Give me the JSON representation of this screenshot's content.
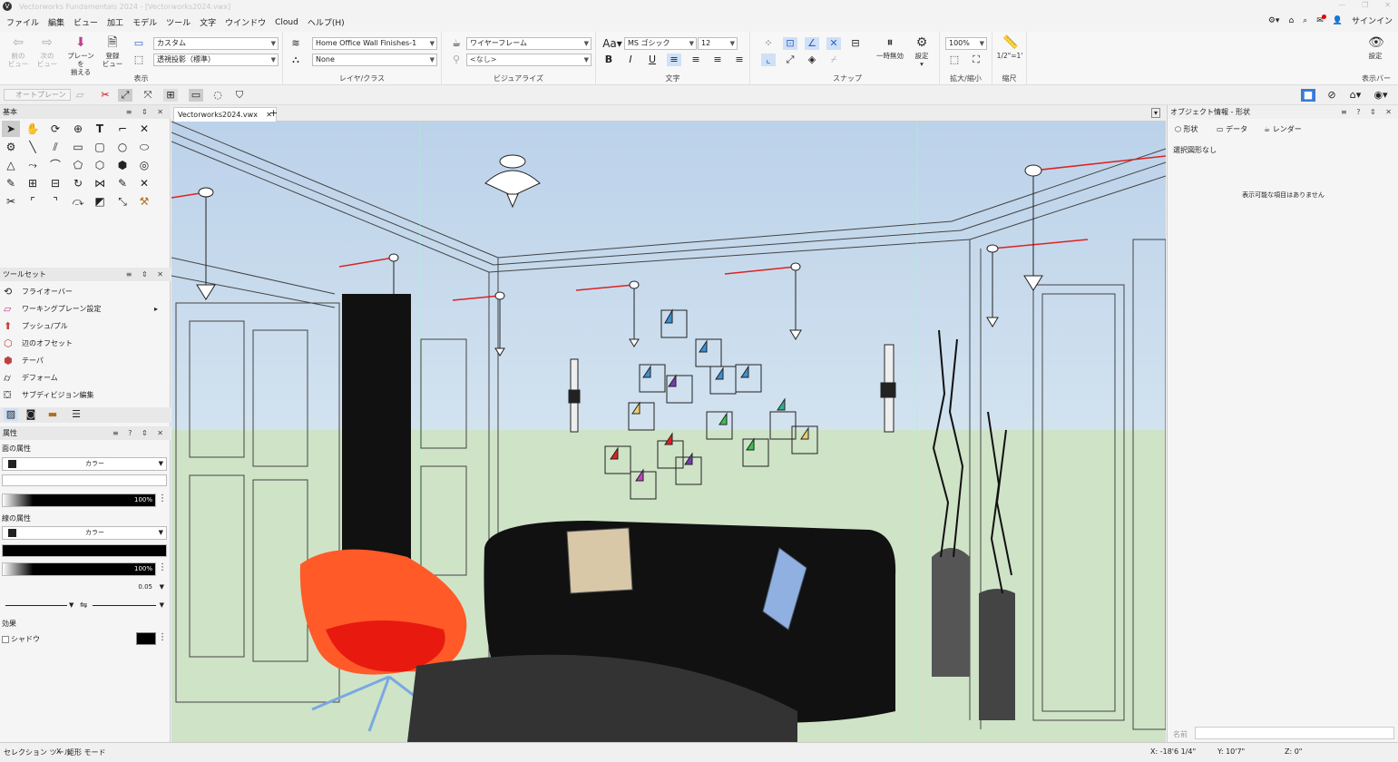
{
  "app": {
    "title": "Vectorworks Fundamentals 2024 - [Vectorworks2024.vwx]",
    "logo": "V"
  },
  "menu": [
    "ファイル",
    "編集",
    "ビュー",
    "加工",
    "モデル",
    "ツール",
    "文字",
    "ウインドウ",
    "Cloud",
    "ヘルプ(H)"
  ],
  "right_menu": {
    "signin": "サインイン"
  },
  "ribbon": {
    "view": {
      "prev": "前の\nビュー",
      "next": "次の\nビュー",
      "align_plane": "プレーンを\n揃える",
      "register": "登録\nビュー",
      "view_dd": "カスタム",
      "proj_dd": "透視投影（標準）",
      "label": "表示"
    },
    "layer": {
      "layer_dd": "Home Office Wall Finishes-1",
      "class_dd": "None",
      "label": "レイヤ/クラス"
    },
    "visual": {
      "render_dd": "ワイヤーフレーム",
      "style_dd": "<なし>",
      "label": "ビジュアライズ"
    },
    "text": {
      "font_dd": "MS ゴシック",
      "size_dd": "12",
      "bold": "B",
      "italic": "I",
      "underline": "U",
      "label": "文字"
    },
    "snap": {
      "pause": "一時無効",
      "settings": "設定",
      "label": "スナップ"
    },
    "zoom": {
      "zoom_dd": "100%",
      "label": "拡大/縮小"
    },
    "scale": {
      "value": "1/2\"=1'",
      "label": "縮尺"
    },
    "displaybar": {
      "settings": "設定",
      "label": "表示バー"
    }
  },
  "toolbar2": {
    "workplane": "オートプレーン"
  },
  "left": {
    "basic_title": "基本",
    "toolset_title": "ツールセット",
    "toolset_items": [
      "フライオーバー",
      "ワーキングプレーン設定",
      "プッシュ/プル",
      "辺のオフセット",
      "テーパ",
      "デフォーム",
      "サブディビジョン編集"
    ],
    "attr_title": "属性",
    "fill_label": "面の属性",
    "fill_type": "カラー",
    "fill_opacity": "100%",
    "line_label": "線の属性",
    "line_type": "カラー",
    "line_opacity": "100%",
    "line_weight": "0.05",
    "effects_label": "効果",
    "shadow_label": "シャドウ"
  },
  "canvas": {
    "tab": "Vectorworks2024.vwx"
  },
  "right": {
    "title": "オブジェクト情報 - 形状",
    "tabs": [
      "形状",
      "データ",
      "レンダー"
    ],
    "selection": "選択図形なし",
    "empty_msg": "表示可能な項目はありません",
    "name_label": "名前"
  },
  "status": {
    "tool": "セレクション ツール",
    "mode": "矩形 モード",
    "x": "X: -18'6 1/4\"",
    "y": "Y: 10'7\"",
    "z": "Z: 0\""
  }
}
